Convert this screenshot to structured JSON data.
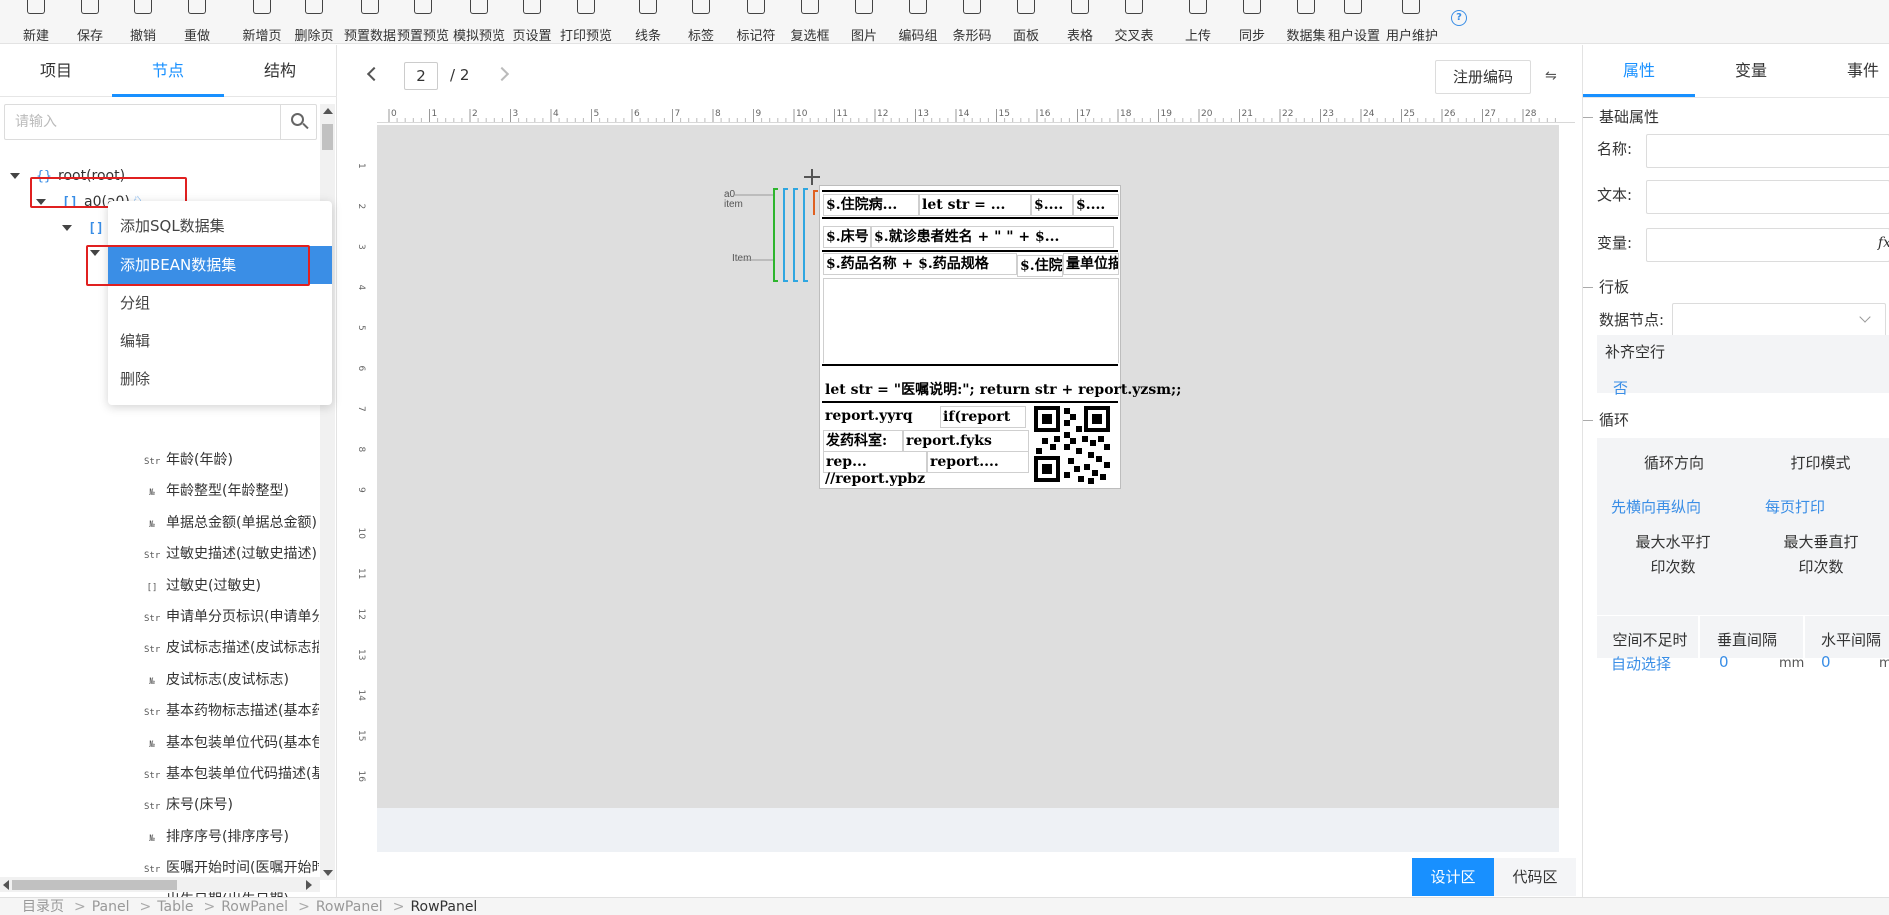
{
  "toolbar": {
    "items": [
      {
        "label": "新建",
        "icon": "new-file-icon"
      },
      {
        "label": "保存",
        "icon": "save-icon"
      },
      {
        "label": "撤销",
        "icon": "undo-icon"
      },
      {
        "label": "重做",
        "icon": "redo-icon"
      },
      {
        "label": "新增页",
        "icon": "add-page-icon"
      },
      {
        "label": "删除页",
        "icon": "delete-page-icon"
      },
      {
        "label": "预置数据",
        "icon": "preset-data-icon"
      },
      {
        "label": "预置预览",
        "icon": "preset-preview-icon"
      },
      {
        "label": "模拟预览",
        "icon": "simulate-preview-icon"
      },
      {
        "label": "页设置",
        "icon": "gear-icon"
      },
      {
        "label": "打印预览",
        "icon": "print-preview-icon"
      },
      {
        "label": "线条",
        "icon": "line-icon"
      },
      {
        "label": "标签",
        "icon": "tag-icon"
      },
      {
        "label": "标记符",
        "icon": "marker-icon"
      },
      {
        "label": "复选框",
        "icon": "checkbox-icon"
      },
      {
        "label": "图片",
        "icon": "image-icon"
      },
      {
        "label": "编码组",
        "icon": "code-group-icon"
      },
      {
        "label": "条形码",
        "icon": "barcode-icon"
      },
      {
        "label": "面板",
        "icon": "panel-icon"
      },
      {
        "label": "表格",
        "icon": "table-icon"
      },
      {
        "label": "交叉表",
        "icon": "crosstab-icon"
      },
      {
        "label": "上传",
        "icon": "upload-icon"
      },
      {
        "label": "同步",
        "icon": "sync-icon"
      },
      {
        "label": "数据集",
        "icon": "dataset-icon"
      },
      {
        "label": "租户设置",
        "icon": "tenant-settings-icon"
      },
      {
        "label": "用户维护",
        "icon": "user-maintenance-icon"
      }
    ],
    "help_icon": "?"
  },
  "left_panel": {
    "tabs": [
      "项目",
      "节点",
      "结构"
    ],
    "active_tab": "节点",
    "search_placeholder": "请输入",
    "tree": {
      "root": {
        "icon": "{}",
        "label": "root(root)"
      },
      "a0": {
        "icon": "[]",
        "label": "a0(a0)"
      },
      "a0_badge": "♘",
      "child_icon": "[]"
    },
    "leaves": [
      {
        "type": "Str",
        "label": "年龄(年龄)"
      },
      {
        "type": "№",
        "label": "年龄整型(年龄整型)"
      },
      {
        "type": "№",
        "label": "单据总金额(单据总金额)"
      },
      {
        "type": "Str",
        "label": "过敏史描述(过敏史描述)"
      },
      {
        "type": "[]",
        "label": "过敏史(过敏史)"
      },
      {
        "type": "Str",
        "label": "申请单分页标识(申请单分页标识)"
      },
      {
        "type": "Str",
        "label": "皮试标志描述(皮试标志描述)"
      },
      {
        "type": "№",
        "label": "皮试标志(皮试标志)"
      },
      {
        "type": "Str",
        "label": "基本药物标志描述(基本药物标志描述)"
      },
      {
        "type": "№",
        "label": "基本包装单位代码(基本包装单位代码)"
      },
      {
        "type": "Str",
        "label": "基本包装单位代码描述(基本包装单位代码描述)"
      },
      {
        "type": "Str",
        "label": "床号(床号)"
      },
      {
        "type": "№",
        "label": "排序序号(排序序号)"
      },
      {
        "type": "Str",
        "label": "医嘱开始时间(医嘱开始时间)"
      },
      {
        "type": "Str",
        "label": "出生日期(出生日期)"
      }
    ],
    "context_menu": [
      "添加SQL数据集",
      "添加BEAN数据集",
      "分组",
      "编辑",
      "删除"
    ],
    "context_menu_active": "添加BEAN数据集"
  },
  "center": {
    "page_current": "2",
    "page_total": "/ 2",
    "register_button": "注册编码",
    "swap_icon": "⇋",
    "ruler_top": [
      "0",
      "1",
      "2",
      "3",
      "4",
      "5",
      "6",
      "7",
      "8",
      "9",
      "10",
      "11",
      "12",
      "13",
      "14",
      "15",
      "16",
      "17",
      "18",
      "19",
      "20",
      "21",
      "22",
      "23",
      "24",
      "25",
      "26",
      "27",
      "28"
    ],
    "ruler_left": [
      "1",
      "2",
      "3",
      "4",
      "5",
      "6",
      "7",
      "8",
      "9",
      "10",
      "11",
      "12",
      "13",
      "14",
      "15",
      "16"
    ],
    "band_labels": {
      "a0": "a0",
      "item1": "item",
      "item2": "Item"
    },
    "report_cells": [
      "$.住院病...",
      "let str = ...",
      "$....",
      "$....",
      "$.床号",
      "$.就诊患者姓名 + \" \" + $...",
      "$.药品名称 + $.药品规格",
      "$.住院",
      "量单位描述",
      "let str = \"医嘱说明:\"; return str + report.yzsm;;",
      "report.yyrq",
      "if(report",
      "发药科室:",
      "report.fyks",
      "rep...",
      "report....",
      "//report.ypbz"
    ],
    "view_tabs": [
      "设计区",
      "代码区"
    ],
    "active_view": "设计区"
  },
  "right_panel": {
    "tabs": [
      "属性",
      "变量",
      "事件"
    ],
    "active_tab": "属性",
    "basic_section": "基础属性",
    "fields": {
      "name": "名称:",
      "text": "文本:",
      "variable": "变量:",
      "fx": "fx"
    },
    "row_panel_section": "行板",
    "data_node_label": "数据节点:",
    "fill_empty_label": "补齐空行",
    "fill_empty_value": "否",
    "loop_section": "循环",
    "loop_direction_label": "循环方向",
    "loop_direction_value": "先横向再纵向",
    "print_mode_label": "打印模式",
    "print_mode_value": "每页打印",
    "max_h_label": "最大水平打印次数",
    "max_v_label": "最大垂直打印次数",
    "space_label": "空间不足时",
    "space_value": "自动选择",
    "v_gap_label": "垂直间隔",
    "v_gap_value": "0",
    "h_gap_label": "水平间隔",
    "h_gap_value": "0",
    "unit": "mm"
  },
  "breadcrumb": [
    "目录页",
    "Panel",
    "Table",
    "RowPanel",
    "RowPanel",
    "RowPanel"
  ],
  "colors": {
    "accent": "#1890ff",
    "highlight_red": "#e02020",
    "canvas_bg": "#dedede"
  }
}
